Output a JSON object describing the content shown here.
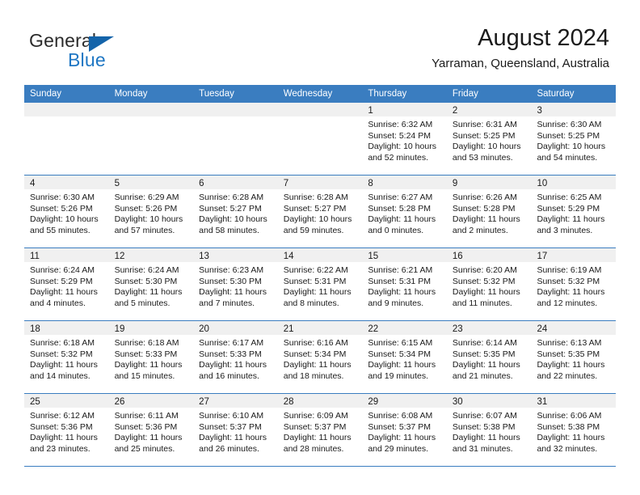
{
  "brand": {
    "name_top": "General",
    "name_bottom": "Blue",
    "accent_color": "#1464aa",
    "blue_text_color": "#1f77c4"
  },
  "header": {
    "title": "August 2024",
    "subtitle": "Yarraman, Queensland, Australia"
  },
  "calendar": {
    "header_bg": "#3a7dc0",
    "daynum_band_bg": "#f0f0f0",
    "weekday_headers": [
      "Sunday",
      "Monday",
      "Tuesday",
      "Wednesday",
      "Thursday",
      "Friday",
      "Saturday"
    ],
    "weeks": [
      [
        {
          "day": "",
          "lines": []
        },
        {
          "day": "",
          "lines": []
        },
        {
          "day": "",
          "lines": []
        },
        {
          "day": "",
          "lines": []
        },
        {
          "day": "1",
          "lines": [
            "Sunrise: 6:32 AM",
            "Sunset: 5:24 PM",
            "Daylight: 10 hours",
            "and 52 minutes."
          ]
        },
        {
          "day": "2",
          "lines": [
            "Sunrise: 6:31 AM",
            "Sunset: 5:25 PM",
            "Daylight: 10 hours",
            "and 53 minutes."
          ]
        },
        {
          "day": "3",
          "lines": [
            "Sunrise: 6:30 AM",
            "Sunset: 5:25 PM",
            "Daylight: 10 hours",
            "and 54 minutes."
          ]
        }
      ],
      [
        {
          "day": "4",
          "lines": [
            "Sunrise: 6:30 AM",
            "Sunset: 5:26 PM",
            "Daylight: 10 hours",
            "and 55 minutes."
          ]
        },
        {
          "day": "5",
          "lines": [
            "Sunrise: 6:29 AM",
            "Sunset: 5:26 PM",
            "Daylight: 10 hours",
            "and 57 minutes."
          ]
        },
        {
          "day": "6",
          "lines": [
            "Sunrise: 6:28 AM",
            "Sunset: 5:27 PM",
            "Daylight: 10 hours",
            "and 58 minutes."
          ]
        },
        {
          "day": "7",
          "lines": [
            "Sunrise: 6:28 AM",
            "Sunset: 5:27 PM",
            "Daylight: 10 hours",
            "and 59 minutes."
          ]
        },
        {
          "day": "8",
          "lines": [
            "Sunrise: 6:27 AM",
            "Sunset: 5:28 PM",
            "Daylight: 11 hours",
            "and 0 minutes."
          ]
        },
        {
          "day": "9",
          "lines": [
            "Sunrise: 6:26 AM",
            "Sunset: 5:28 PM",
            "Daylight: 11 hours",
            "and 2 minutes."
          ]
        },
        {
          "day": "10",
          "lines": [
            "Sunrise: 6:25 AM",
            "Sunset: 5:29 PM",
            "Daylight: 11 hours",
            "and 3 minutes."
          ]
        }
      ],
      [
        {
          "day": "11",
          "lines": [
            "Sunrise: 6:24 AM",
            "Sunset: 5:29 PM",
            "Daylight: 11 hours",
            "and 4 minutes."
          ]
        },
        {
          "day": "12",
          "lines": [
            "Sunrise: 6:24 AM",
            "Sunset: 5:30 PM",
            "Daylight: 11 hours",
            "and 5 minutes."
          ]
        },
        {
          "day": "13",
          "lines": [
            "Sunrise: 6:23 AM",
            "Sunset: 5:30 PM",
            "Daylight: 11 hours",
            "and 7 minutes."
          ]
        },
        {
          "day": "14",
          "lines": [
            "Sunrise: 6:22 AM",
            "Sunset: 5:31 PM",
            "Daylight: 11 hours",
            "and 8 minutes."
          ]
        },
        {
          "day": "15",
          "lines": [
            "Sunrise: 6:21 AM",
            "Sunset: 5:31 PM",
            "Daylight: 11 hours",
            "and 9 minutes."
          ]
        },
        {
          "day": "16",
          "lines": [
            "Sunrise: 6:20 AM",
            "Sunset: 5:32 PM",
            "Daylight: 11 hours",
            "and 11 minutes."
          ]
        },
        {
          "day": "17",
          "lines": [
            "Sunrise: 6:19 AM",
            "Sunset: 5:32 PM",
            "Daylight: 11 hours",
            "and 12 minutes."
          ]
        }
      ],
      [
        {
          "day": "18",
          "lines": [
            "Sunrise: 6:18 AM",
            "Sunset: 5:32 PM",
            "Daylight: 11 hours",
            "and 14 minutes."
          ]
        },
        {
          "day": "19",
          "lines": [
            "Sunrise: 6:18 AM",
            "Sunset: 5:33 PM",
            "Daylight: 11 hours",
            "and 15 minutes."
          ]
        },
        {
          "day": "20",
          "lines": [
            "Sunrise: 6:17 AM",
            "Sunset: 5:33 PM",
            "Daylight: 11 hours",
            "and 16 minutes."
          ]
        },
        {
          "day": "21",
          "lines": [
            "Sunrise: 6:16 AM",
            "Sunset: 5:34 PM",
            "Daylight: 11 hours",
            "and 18 minutes."
          ]
        },
        {
          "day": "22",
          "lines": [
            "Sunrise: 6:15 AM",
            "Sunset: 5:34 PM",
            "Daylight: 11 hours",
            "and 19 minutes."
          ]
        },
        {
          "day": "23",
          "lines": [
            "Sunrise: 6:14 AM",
            "Sunset: 5:35 PM",
            "Daylight: 11 hours",
            "and 21 minutes."
          ]
        },
        {
          "day": "24",
          "lines": [
            "Sunrise: 6:13 AM",
            "Sunset: 5:35 PM",
            "Daylight: 11 hours",
            "and 22 minutes."
          ]
        }
      ],
      [
        {
          "day": "25",
          "lines": [
            "Sunrise: 6:12 AM",
            "Sunset: 5:36 PM",
            "Daylight: 11 hours",
            "and 23 minutes."
          ]
        },
        {
          "day": "26",
          "lines": [
            "Sunrise: 6:11 AM",
            "Sunset: 5:36 PM",
            "Daylight: 11 hours",
            "and 25 minutes."
          ]
        },
        {
          "day": "27",
          "lines": [
            "Sunrise: 6:10 AM",
            "Sunset: 5:37 PM",
            "Daylight: 11 hours",
            "and 26 minutes."
          ]
        },
        {
          "day": "28",
          "lines": [
            "Sunrise: 6:09 AM",
            "Sunset: 5:37 PM",
            "Daylight: 11 hours",
            "and 28 minutes."
          ]
        },
        {
          "day": "29",
          "lines": [
            "Sunrise: 6:08 AM",
            "Sunset: 5:37 PM",
            "Daylight: 11 hours",
            "and 29 minutes."
          ]
        },
        {
          "day": "30",
          "lines": [
            "Sunrise: 6:07 AM",
            "Sunset: 5:38 PM",
            "Daylight: 11 hours",
            "and 31 minutes."
          ]
        },
        {
          "day": "31",
          "lines": [
            "Sunrise: 6:06 AM",
            "Sunset: 5:38 PM",
            "Daylight: 11 hours",
            "and 32 minutes."
          ]
        }
      ]
    ]
  }
}
